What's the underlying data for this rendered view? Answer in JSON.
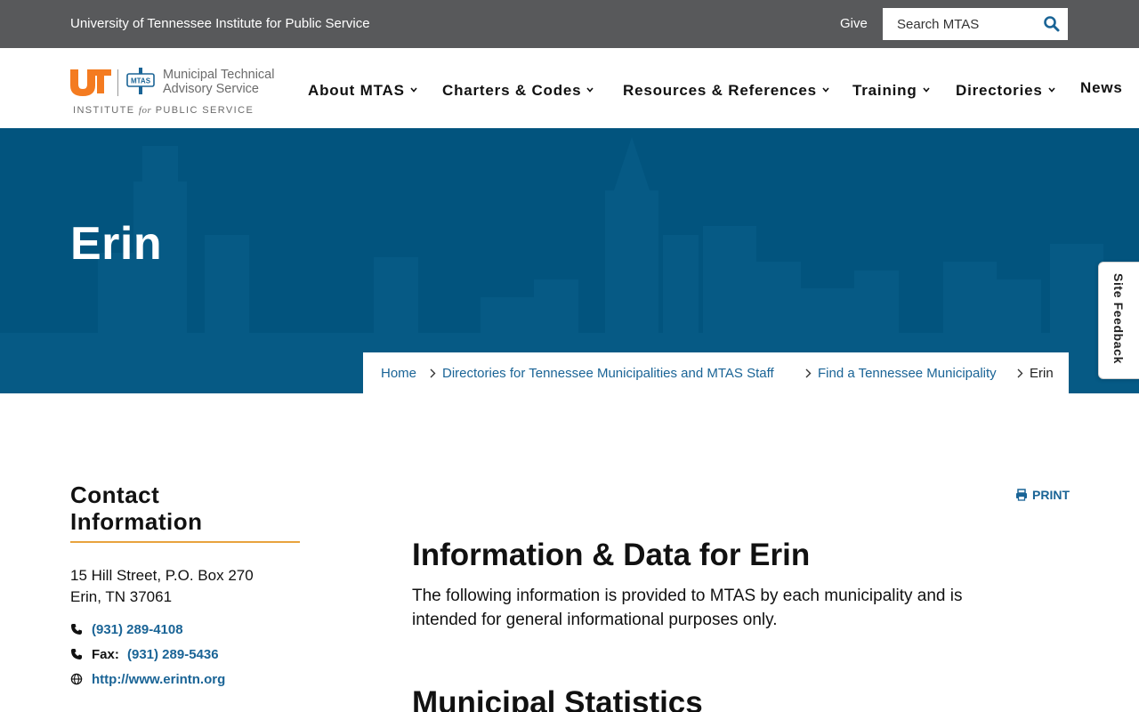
{
  "topbar": {
    "org_name": "University of Tennessee Institute for Public Service",
    "give_label": "Give",
    "search_placeholder": "Search MTAS"
  },
  "logo": {
    "mark": "UT",
    "badge": "MTAS",
    "name_line1": "Municipal Technical",
    "name_line2": "Advisory Service",
    "tag_pre": "INSTITUTE ",
    "tag_mid": "for",
    "tag_post": " PUBLIC SERVICE"
  },
  "nav": {
    "items": [
      {
        "label": "About MTAS",
        "has_dropdown": true
      },
      {
        "label": "Charters & Codes",
        "has_dropdown": true
      },
      {
        "label": "Resources & References",
        "has_dropdown": true
      },
      {
        "label": "Training",
        "has_dropdown": true
      },
      {
        "label": "Directories",
        "has_dropdown": true
      },
      {
        "label": "News",
        "has_dropdown": false
      }
    ]
  },
  "hero": {
    "title": "Erin"
  },
  "breadcrumb": {
    "items": [
      "Home",
      "Directories for Tennessee Municipalities and MTAS Staff",
      "Find a Tennessee Municipality"
    ],
    "current": "Erin"
  },
  "feedback": {
    "label": "Site Feedback"
  },
  "contact": {
    "title_line1": "Contact",
    "title_line2": "Information",
    "address_line1": "15 Hill Street, P.O. Box 270",
    "address_line2": "Erin, TN 37061",
    "phone": "(931) 289-4108",
    "fax_label": "Fax:",
    "fax": "(931) 289-5436",
    "website": "http://www.erintn.org"
  },
  "main": {
    "print_label": "PRINT",
    "title": "Information & Data for Erin",
    "intro": "The following information is provided to MTAS by each municipality and is intended for general informational purposes only.",
    "stats_title": "Municipal Statistics"
  },
  "colors": {
    "topbar": "#58595b",
    "hero": "#02547e",
    "link": "#1a6496",
    "accent_orange": "#e8a33d",
    "ut_orange": "#f47b20"
  }
}
